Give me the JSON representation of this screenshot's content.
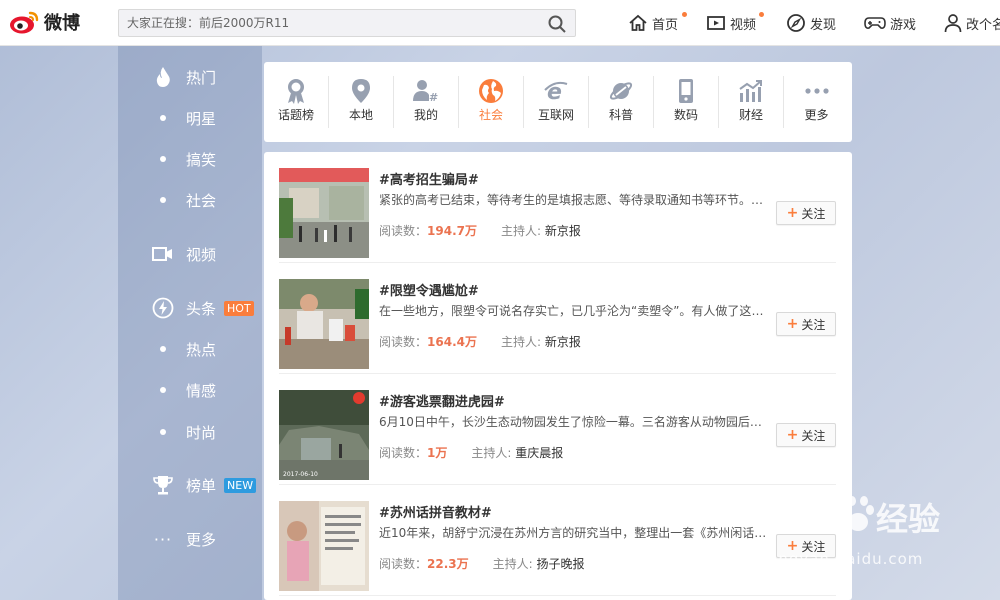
{
  "header": {
    "logo_text": "微博",
    "search_placeholder": "大家正在搜：前后2000万R11",
    "nav": [
      {
        "label": "首页",
        "dot": true
      },
      {
        "label": "视频",
        "dot": true
      },
      {
        "label": "发现",
        "dot": false
      },
      {
        "label": "游戏",
        "dot": false
      },
      {
        "label": "改个名",
        "dot": false
      }
    ]
  },
  "sidebar": {
    "items": [
      {
        "label": "热门",
        "icon": "fire-icon"
      },
      {
        "label": "明星"
      },
      {
        "label": "搞笑"
      },
      {
        "label": "社会"
      },
      {
        "label": "视频",
        "icon": "video-camera-icon"
      },
      {
        "label": "头条",
        "icon": "lightning-icon",
        "badge": "HOT"
      },
      {
        "label": "热点"
      },
      {
        "label": "情感"
      },
      {
        "label": "时尚"
      },
      {
        "label": "榜单",
        "icon": "trophy-icon",
        "badge": "NEW"
      },
      {
        "label": "更多",
        "icon": "ellipsis-icon"
      }
    ]
  },
  "categories": [
    {
      "label": "话题榜",
      "icon": "award-ribbon-icon"
    },
    {
      "label": "本地",
      "icon": "location-pin-icon"
    },
    {
      "label": "我的",
      "icon": "user-hash-icon"
    },
    {
      "label": "社会",
      "icon": "globe-icon",
      "active": true
    },
    {
      "label": "互联网",
      "icon": "browser-e-icon"
    },
    {
      "label": "科普",
      "icon": "planet-icon"
    },
    {
      "label": "数码",
      "icon": "phone-icon"
    },
    {
      "label": "财经",
      "icon": "stock-chart-icon"
    },
    {
      "label": "更多",
      "icon": "more-dots-icon"
    }
  ],
  "topics": [
    {
      "title": "#高考招生骗局#",
      "desc": "紧张的高考已结束，等待考生的是填报志愿、等待录取通知书等环节。对...",
      "read_label": "阅读数：",
      "reads": "194.7万",
      "host_label": "主持人:",
      "host": "新京报",
      "follow": "关注"
    },
    {
      "title": "#限塑令遇尴尬#",
      "desc": "在一些地方，限塑令可说名存实亡，已几乎沦为“卖塑令”。有人做了这样...",
      "read_label": "阅读数：",
      "reads": "164.4万",
      "host_label": "主持人:",
      "host": "新京报",
      "follow": "关注"
    },
    {
      "title": "#游客逃票翻进虎园#",
      "desc": "6月10日中午，长沙生态动物园发生了惊险一幕。三名游客从动物园后山翻...",
      "read_label": "阅读数：",
      "reads": "1万",
      "host_label": "主持人:",
      "host": "重庆晨报",
      "follow": "关注"
    },
    {
      "title": "#苏州话拼音教材#",
      "desc": "近10年来，胡舒宁沉浸在苏州方言的研究当中，整理出一套《苏州闲话拼...",
      "read_label": "阅读数：",
      "reads": "22.3万",
      "host_label": "主持人:",
      "host": "扬子晚报",
      "follow": "关注"
    }
  ],
  "watermark": {
    "brand": "Bai",
    "brand2": "经验",
    "url": "jingyan.baidu.com"
  },
  "colors": {
    "accent": "#fa7d3c",
    "reads": "#eb7350",
    "hot": "#fa7d3c",
    "new": "#2e9bdf"
  }
}
